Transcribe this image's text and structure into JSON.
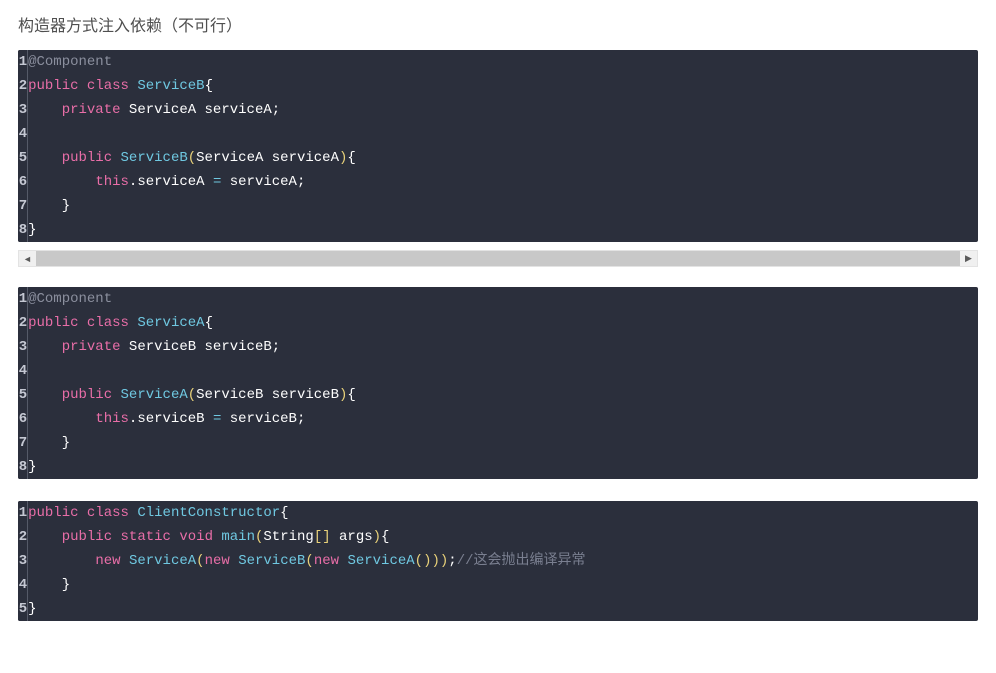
{
  "heading": "构造器方式注入依赖（不可行）",
  "blocks": [
    {
      "lines": 8,
      "tokens": [
        [
          {
            "t": "@Component",
            "c": "tok-annotation"
          }
        ],
        [
          {
            "t": "public",
            "c": "tok-keyword"
          },
          {
            "t": " ",
            "c": ""
          },
          {
            "t": "class",
            "c": "tok-keyword"
          },
          {
            "t": " ",
            "c": ""
          },
          {
            "t": "ServiceB",
            "c": "tok-method"
          },
          {
            "t": "{",
            "c": "tok-brace"
          }
        ],
        [
          {
            "t": "    ",
            "c": ""
          },
          {
            "t": "private",
            "c": "tok-keyword"
          },
          {
            "t": " ",
            "c": ""
          },
          {
            "t": "ServiceA serviceA",
            "c": "tok-type"
          },
          {
            "t": ";",
            "c": "tok-punct"
          }
        ],
        [
          {
            "t": " ",
            "c": ""
          }
        ],
        [
          {
            "t": "    ",
            "c": ""
          },
          {
            "t": "public",
            "c": "tok-keyword"
          },
          {
            "t": " ",
            "c": ""
          },
          {
            "t": "ServiceB",
            "c": "tok-method"
          },
          {
            "t": "(",
            "c": "tok-paren"
          },
          {
            "t": "ServiceA serviceA",
            "c": "tok-type"
          },
          {
            "t": ")",
            "c": "tok-paren"
          },
          {
            "t": "{",
            "c": "tok-brace"
          }
        ],
        [
          {
            "t": "        ",
            "c": ""
          },
          {
            "t": "this",
            "c": "tok-this"
          },
          {
            "t": ".serviceA ",
            "c": "tok-type"
          },
          {
            "t": "=",
            "c": "tok-op"
          },
          {
            "t": " serviceA",
            "c": "tok-type"
          },
          {
            "t": ";",
            "c": "tok-punct"
          }
        ],
        [
          {
            "t": "    ",
            "c": ""
          },
          {
            "t": "}",
            "c": "tok-brace"
          }
        ],
        [
          {
            "t": "}",
            "c": "tok-brace"
          }
        ]
      ]
    },
    {
      "lines": 8,
      "tokens": [
        [
          {
            "t": "@Component",
            "c": "tok-annotation"
          }
        ],
        [
          {
            "t": "public",
            "c": "tok-keyword"
          },
          {
            "t": " ",
            "c": ""
          },
          {
            "t": "class",
            "c": "tok-keyword"
          },
          {
            "t": " ",
            "c": ""
          },
          {
            "t": "ServiceA",
            "c": "tok-method"
          },
          {
            "t": "{",
            "c": "tok-brace"
          }
        ],
        [
          {
            "t": "    ",
            "c": ""
          },
          {
            "t": "private",
            "c": "tok-keyword"
          },
          {
            "t": " ",
            "c": ""
          },
          {
            "t": "ServiceB serviceB",
            "c": "tok-type"
          },
          {
            "t": ";",
            "c": "tok-punct"
          }
        ],
        [
          {
            "t": " ",
            "c": ""
          }
        ],
        [
          {
            "t": "    ",
            "c": ""
          },
          {
            "t": "public",
            "c": "tok-keyword"
          },
          {
            "t": " ",
            "c": ""
          },
          {
            "t": "ServiceA",
            "c": "tok-method"
          },
          {
            "t": "(",
            "c": "tok-paren"
          },
          {
            "t": "ServiceB serviceB",
            "c": "tok-type"
          },
          {
            "t": ")",
            "c": "tok-paren"
          },
          {
            "t": "{",
            "c": "tok-brace"
          }
        ],
        [
          {
            "t": "        ",
            "c": ""
          },
          {
            "t": "this",
            "c": "tok-this"
          },
          {
            "t": ".serviceB ",
            "c": "tok-type"
          },
          {
            "t": "=",
            "c": "tok-op"
          },
          {
            "t": " serviceB",
            "c": "tok-type"
          },
          {
            "t": ";",
            "c": "tok-punct"
          }
        ],
        [
          {
            "t": "    ",
            "c": ""
          },
          {
            "t": "}",
            "c": "tok-brace"
          }
        ],
        [
          {
            "t": "}",
            "c": "tok-brace"
          }
        ]
      ]
    },
    {
      "lines": 5,
      "tokens": [
        [
          {
            "t": "public",
            "c": "tok-keyword"
          },
          {
            "t": " ",
            "c": ""
          },
          {
            "t": "class",
            "c": "tok-keyword"
          },
          {
            "t": " ",
            "c": ""
          },
          {
            "t": "ClientConstructor",
            "c": "tok-method"
          },
          {
            "t": "{",
            "c": "tok-brace"
          }
        ],
        [
          {
            "t": "    ",
            "c": ""
          },
          {
            "t": "public",
            "c": "tok-keyword"
          },
          {
            "t": " ",
            "c": ""
          },
          {
            "t": "static",
            "c": "tok-keyword"
          },
          {
            "t": " ",
            "c": ""
          },
          {
            "t": "void",
            "c": "tok-keyword"
          },
          {
            "t": " ",
            "c": ""
          },
          {
            "t": "main",
            "c": "tok-method"
          },
          {
            "t": "(",
            "c": "tok-paren"
          },
          {
            "t": "String",
            "c": "tok-type"
          },
          {
            "t": "[]",
            "c": "tok-paren"
          },
          {
            "t": " args",
            "c": "tok-type"
          },
          {
            "t": ")",
            "c": "tok-paren"
          },
          {
            "t": "{",
            "c": "tok-brace"
          }
        ],
        [
          {
            "t": "        ",
            "c": ""
          },
          {
            "t": "new",
            "c": "tok-keyword"
          },
          {
            "t": " ",
            "c": ""
          },
          {
            "t": "ServiceA",
            "c": "tok-method"
          },
          {
            "t": "(",
            "c": "tok-paren"
          },
          {
            "t": "new",
            "c": "tok-keyword"
          },
          {
            "t": " ",
            "c": ""
          },
          {
            "t": "ServiceB",
            "c": "tok-method"
          },
          {
            "t": "(",
            "c": "tok-paren"
          },
          {
            "t": "new",
            "c": "tok-keyword"
          },
          {
            "t": " ",
            "c": ""
          },
          {
            "t": "ServiceA",
            "c": "tok-method"
          },
          {
            "t": "(",
            "c": "tok-paren"
          },
          {
            "t": ")",
            "c": "tok-paren"
          },
          {
            "t": ")",
            "c": "tok-paren"
          },
          {
            "t": ")",
            "c": "tok-paren"
          },
          {
            "t": ";",
            "c": "tok-punct"
          },
          {
            "t": "//这会抛出编译异常",
            "c": "tok-comment"
          }
        ],
        [
          {
            "t": "    ",
            "c": ""
          },
          {
            "t": "}",
            "c": "tok-brace"
          }
        ],
        [
          {
            "t": "}",
            "c": "tok-brace"
          }
        ]
      ]
    }
  ],
  "scroll": {
    "left_glyph": "◄",
    "right_glyph": "▶"
  }
}
